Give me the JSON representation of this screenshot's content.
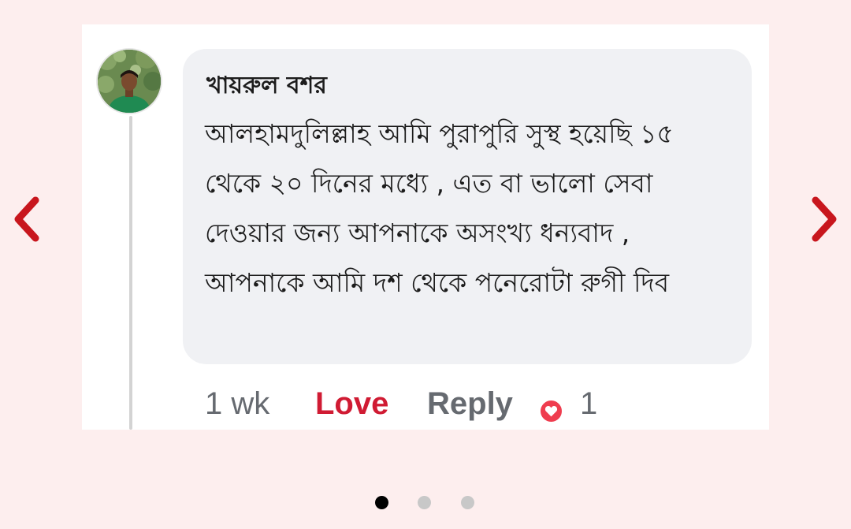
{
  "comment": {
    "author": "খায়রুল বশর",
    "text": "আলহামদুলিল্লাহ আমি পুরাপুরি সুস্থ হয়েছি ১৫ থেকে ২০ দিনের মধ্যে , এত বা ভালো সেবা দেওয়ার জন্য আপনাকে অসংখ্য ধন্যবাদ , আপনাকে আমি দশ থেকে পনেরোটা রুগী দিব",
    "timestamp": "1 wk",
    "love_label": "Love",
    "reply_label": "Reply",
    "reaction_count": "1",
    "reaction_icon": "heart-icon"
  },
  "carousel": {
    "prev_icon": "chevron-left-icon",
    "next_icon": "chevron-right-icon",
    "total_slides": 3,
    "active_slide": 1
  },
  "colors": {
    "page_background": "#fdeeee",
    "accent": "#c8161d",
    "love": "#d01b33",
    "bubble": "#f0f1f4",
    "meta_text": "#666a70"
  }
}
